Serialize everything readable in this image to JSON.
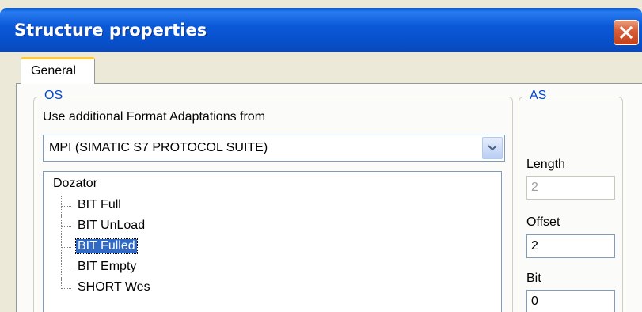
{
  "window": {
    "title": "Structure properties"
  },
  "tabs": [
    {
      "label": "General",
      "active": true
    }
  ],
  "os_group": {
    "label": "OS",
    "format_label": "Use additional Format Adaptations from",
    "format_value": "MPI (SIMATIC S7 PROTOCOL SUITE)",
    "tree": {
      "root": "Dozator",
      "items": [
        {
          "label": "BIT Full",
          "selected": false
        },
        {
          "label": "BIT UnLoad",
          "selected": false
        },
        {
          "label": "BIT Fulled",
          "selected": true
        },
        {
          "label": "BIT Empty",
          "selected": false
        },
        {
          "label": "SHORT Wes",
          "selected": false
        }
      ]
    }
  },
  "as_group": {
    "label": "AS",
    "length_label": "Length",
    "length_value": "2",
    "offset_label": "Offset",
    "offset_value": "2",
    "bit_label": "Bit",
    "bit_value": "0"
  },
  "icons": {
    "close": "close-x-icon",
    "dropdown": "chevron-down-icon"
  },
  "colors": {
    "titlebar": "#0b59d8",
    "close_button": "#d8603a",
    "group_label": "#0046d5",
    "selection": "#316ac5",
    "tab_highlight": "#ffc83c"
  }
}
